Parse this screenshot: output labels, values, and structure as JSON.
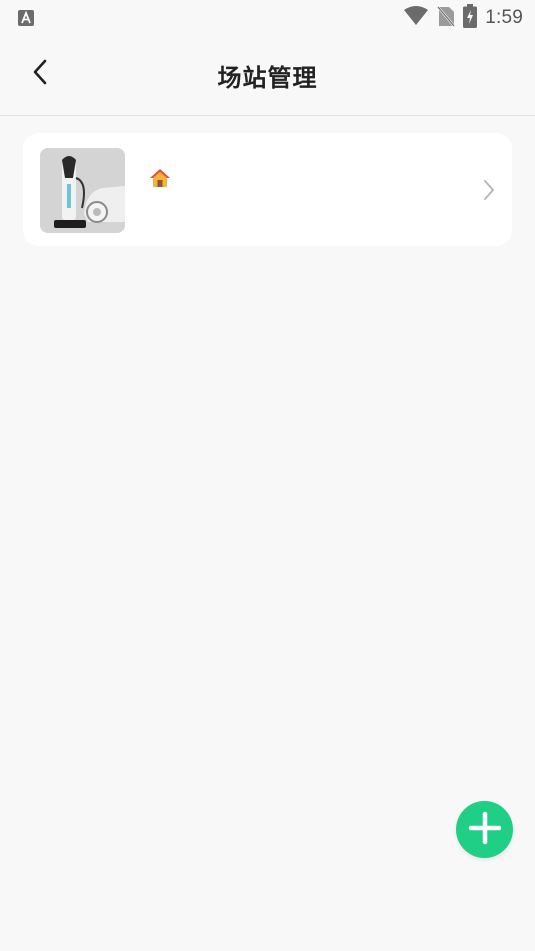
{
  "status_bar": {
    "time": "1:59",
    "app_icon": "a-notification-icon",
    "icons": [
      "wifi-icon",
      "no-sim-icon",
      "battery-charging-icon"
    ]
  },
  "header": {
    "title": "场站管理",
    "back_icon": "back-arrow-icon"
  },
  "stations": [
    {
      "name": "",
      "thumbnail": "charging-station-image",
      "home_icon": "home-icon",
      "chevron_icon": "chevron-right-icon"
    }
  ],
  "fab": {
    "icon": "plus-icon",
    "color": "#1fcf86"
  },
  "colors": {
    "background": "#f8f8f8",
    "card": "#ffffff",
    "accent": "#1fcf86",
    "title": "#222222"
  }
}
